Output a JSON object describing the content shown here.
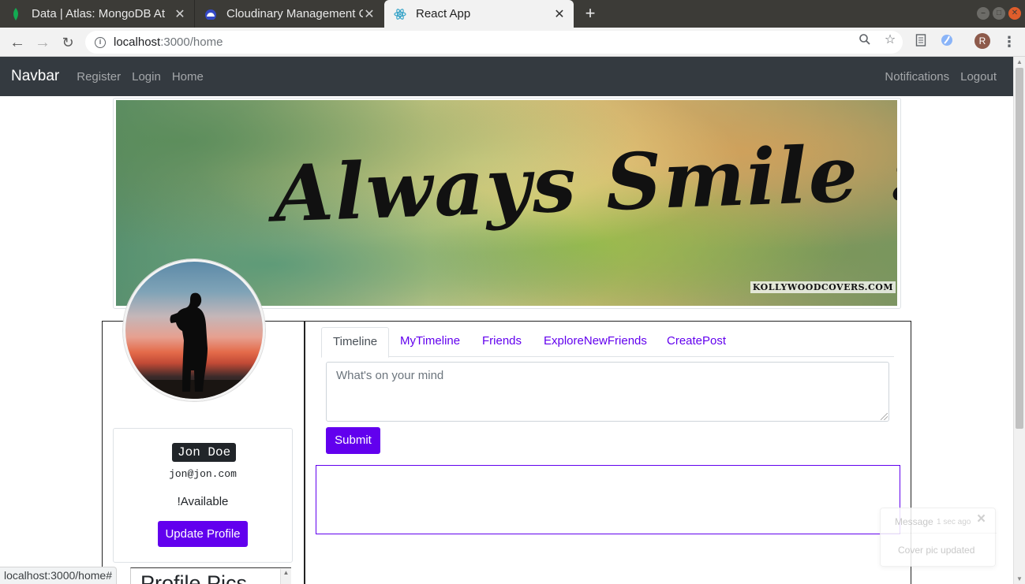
{
  "browser": {
    "tabs": [
      {
        "title": "Data | Atlas: MongoDB At",
        "icon": "mongodb-leaf-icon",
        "active": false
      },
      {
        "title": "Cloudinary Management C",
        "icon": "cloudinary-cloud-icon",
        "active": false
      },
      {
        "title": "React App",
        "icon": "react-atom-icon",
        "active": true
      }
    ],
    "address": {
      "host": "localhost",
      "path": ":3000/home"
    },
    "profile_initial": "R",
    "status_url": "localhost:3000/home#"
  },
  "navbar": {
    "brand": "Navbar",
    "left_links": [
      "Register",
      "Login",
      "Home"
    ],
    "right_links": [
      "Notifications",
      "Logout"
    ]
  },
  "cover": {
    "text": "Always Smile :)",
    "watermark": "KOLLYWOODCOVERS.COM"
  },
  "profile": {
    "name": "Jon Doe",
    "email": "jon@jon.com",
    "status": "!Available",
    "update_button": "Update Profile",
    "pics_heading": "Profile Pics"
  },
  "tabs": [
    "Timeline",
    "MyTimeline",
    "Friends",
    "ExploreNewFriends",
    "CreatePost"
  ],
  "post": {
    "placeholder": "What's on your mind",
    "submit_label": "Submit"
  },
  "toast": {
    "title": "Message",
    "time": "1 sec ago",
    "body": "Cover pic updated"
  },
  "colors": {
    "accent": "#6200ee",
    "navbar_bg": "#343a40"
  }
}
